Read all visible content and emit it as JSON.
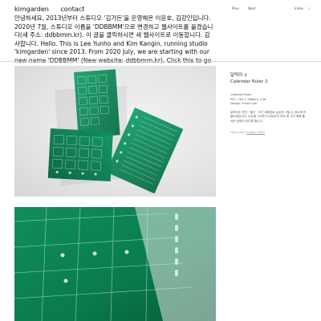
{
  "nav": {
    "brand": "kimgarden",
    "contact": "contact"
  },
  "intro": {
    "text": "안녕하세요, 2013년부터 스튜디오 '김가든'을 운영해온 이윤호, 김강인입니다. 2020년 7월, 스튜디오 이름을 'DDBBMM'으로 변경하고 웹사이트를 옮겼습니다(새 주소: ddbbmm.kr). 이 글을 클릭하시면 새 웹사이트로 이동합니다. 감사합니다. Hello. This is Lee Yunho and Kim Kangin, running studio 'kimgarden' since 2013. From 2020 July, we are starting with our new name 'DDBBMM' (New website: ddbbmm.kr). Click this to go to the new website. Thank you."
  },
  "pager": {
    "prev": "Prev",
    "next": "Next"
  },
  "index": {
    "index": "Index",
    "info": "i"
  },
  "caption": {
    "title_ko": "달력자 2",
    "title_en": "Calendar Ruler 2",
    "lines": [
      "Calendar Ruler",
      "PET, 130 × 188mm, 0.8t",
      "Design: Yunho Lee"
    ],
    "description": "달력자는 연간 · 월간 · 주간 계획표로 손쉽게 그릴 수 있도록 만들어졌습니다. 노트에 그리면 다이어리가 되어 매 그리 매해 풀어쓴 달력이 되도록 합니다.",
    "filed_label": "Filed under",
    "filed_link": "Graphic Ruler"
  },
  "colors": {
    "ruler_green": "#0e8a5a",
    "ruler_dark": "#066841",
    "photo_bg": "#e6e6e6"
  }
}
